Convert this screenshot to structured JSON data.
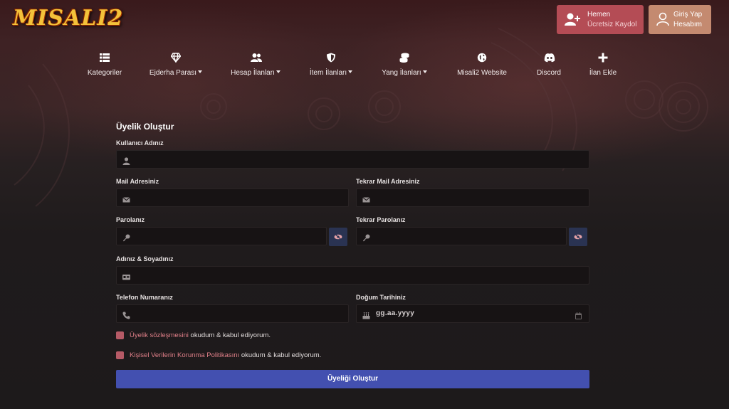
{
  "header": {
    "logo_text": "MISALI2",
    "register": {
      "line1": "Hemen",
      "line2": "Ücretsiz Kaydol"
    },
    "login": {
      "line1": "Giriş Yap",
      "line2": "Hesabım"
    }
  },
  "nav": {
    "items": [
      {
        "label": "Kategoriler",
        "icon": "list-icon",
        "dropdown": false
      },
      {
        "label": "Ejderha Parası",
        "icon": "diamond-icon",
        "dropdown": true
      },
      {
        "label": "Hesap İlanları",
        "icon": "users-icon",
        "dropdown": true
      },
      {
        "label": "İtem İlanları",
        "icon": "shield-icon",
        "dropdown": true
      },
      {
        "label": "Yang İlanları",
        "icon": "coins-icon",
        "dropdown": true
      },
      {
        "label": "Misali2 Website",
        "icon": "globe-icon",
        "dropdown": false
      },
      {
        "label": "Discord",
        "icon": "discord-icon",
        "dropdown": false
      },
      {
        "label": "İlan Ekle",
        "icon": "plus-icon",
        "dropdown": false
      }
    ]
  },
  "form": {
    "title": "Üyelik Oluştur",
    "username_label": "Kullanıcı Adınız",
    "email_label": "Mail Adresiniz",
    "email_repeat_label": "Tekrar Mail Adresiniz",
    "password_label": "Parolanız",
    "password_repeat_label": "Tekrar Parolanız",
    "fullname_label": "Adınız & Soyadınız",
    "phone_label": "Telefon Numaranız",
    "birthdate_label": "Doğum Tarihiniz",
    "birthdate_placeholder": "gg.aa.yyyy",
    "agreement": {
      "link": "Üyelik sözleşmesini",
      "text": " okudum & kabul ediyorum."
    },
    "privacy": {
      "link": "Kişisel Verilerin Korunma Politikasını",
      "text": " okudum & kabul ediyorum."
    },
    "submit_label": "Üyeliği Oluştur"
  },
  "colors": {
    "register_button": "#b44c55",
    "login_button": "#c48a70",
    "submit_button": "#4350b0",
    "link": "#e07f88",
    "checkbox": "#b65a66"
  }
}
